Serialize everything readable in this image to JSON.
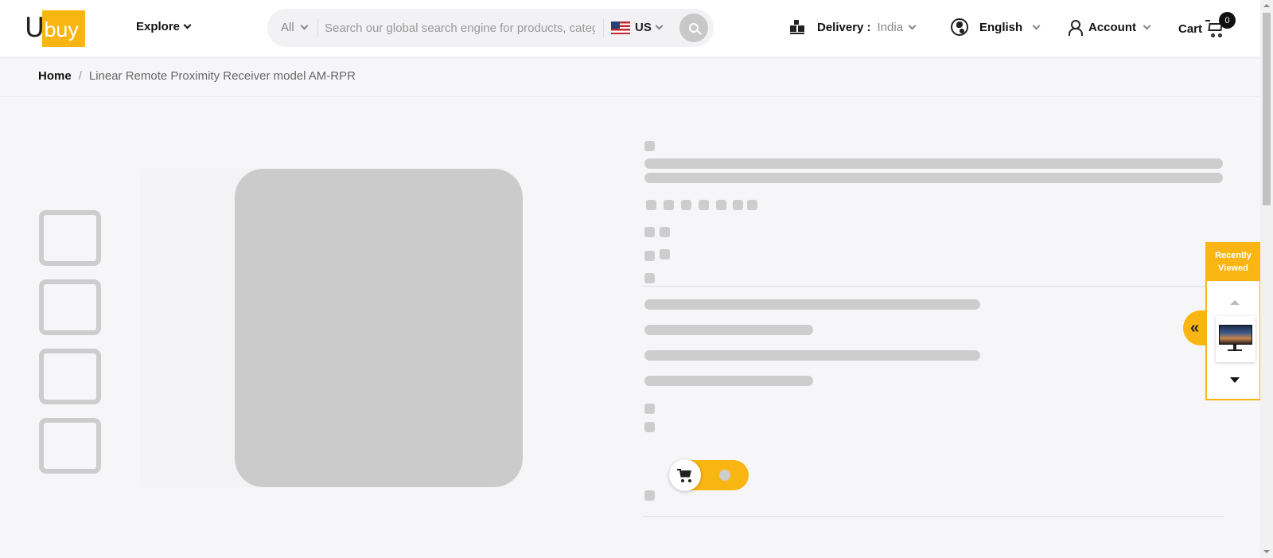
{
  "header": {
    "logo": {
      "brand_text": "Ubuy",
      "brand_color": "#f9b612"
    },
    "explore_label": "Explore",
    "search": {
      "category": "All",
      "placeholder": "Search our global search engine for products, categories, brands",
      "country": "US",
      "search_icon": "search-icon"
    },
    "delivery": {
      "label": "Delivery :",
      "value": "India",
      "icon": "boxes-icon"
    },
    "language": {
      "label": "English",
      "icon": "globe-icon"
    },
    "account": {
      "label": "Account",
      "icon": "user-icon"
    },
    "cart": {
      "label": "Cart",
      "count": "0",
      "icon": "cart-icon"
    }
  },
  "breadcrumb": {
    "home": "Home",
    "separator": "/",
    "current": "Linear Remote Proximity Receiver model AM-RPR"
  },
  "recently_viewed": {
    "title": "Recently Viewed",
    "toggle_symbol": "«"
  },
  "colors": {
    "accent": "#f9b612",
    "skeleton": "#cdcdcd",
    "background": "#f6f6f8"
  }
}
